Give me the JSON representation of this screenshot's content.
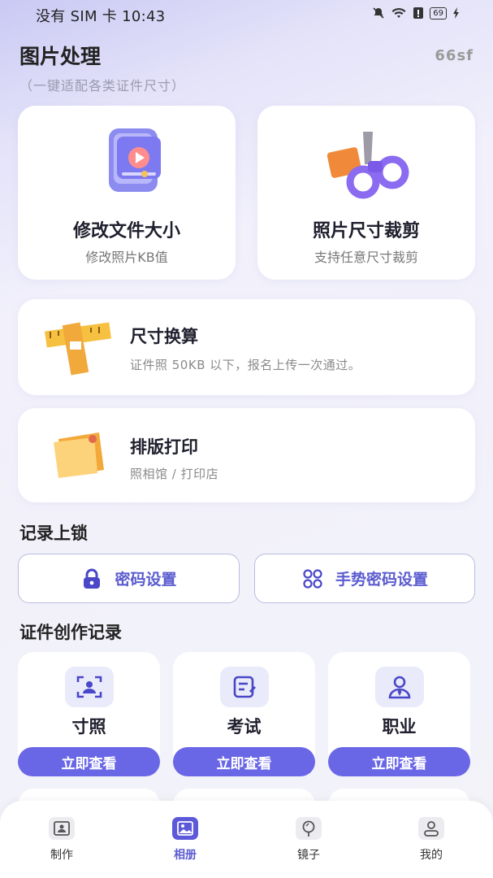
{
  "status": {
    "left": "没有 SIM 卡 10:43",
    "battery": "69"
  },
  "header": {
    "title": "图片处理",
    "subtitle": "（一键适配各类证件尺寸）",
    "brand": "66sf"
  },
  "cards": {
    "resize": {
      "title": "修改文件大小",
      "sub": "修改照片KB值"
    },
    "crop": {
      "title": "照片尺寸裁剪",
      "sub": "支持任意尺寸裁剪"
    },
    "convert": {
      "title": "尺寸换算",
      "sub": "证件照 50KB 以下，报名上传一次通过。"
    },
    "print": {
      "title": "排版打印",
      "sub": "照相馆 / 打印店"
    }
  },
  "lock_section": {
    "title": "记录上锁",
    "password": "密码设置",
    "gesture": "手势密码设置"
  },
  "records": {
    "title": "证件创作记录",
    "items": [
      {
        "label": "寸照",
        "button": "立即查看"
      },
      {
        "label": "考试",
        "button": "立即查看"
      },
      {
        "label": "职业",
        "button": "立即查看"
      }
    ]
  },
  "tabs": [
    {
      "label": "制作",
      "icon": "id-card-icon"
    },
    {
      "label": "相册",
      "icon": "image-icon"
    },
    {
      "label": "镜子",
      "icon": "mirror-icon"
    },
    {
      "label": "我的",
      "icon": "user-icon"
    }
  ],
  "colors": {
    "accent": "#6a67e6",
    "accent_text": "#5b5bd0"
  }
}
